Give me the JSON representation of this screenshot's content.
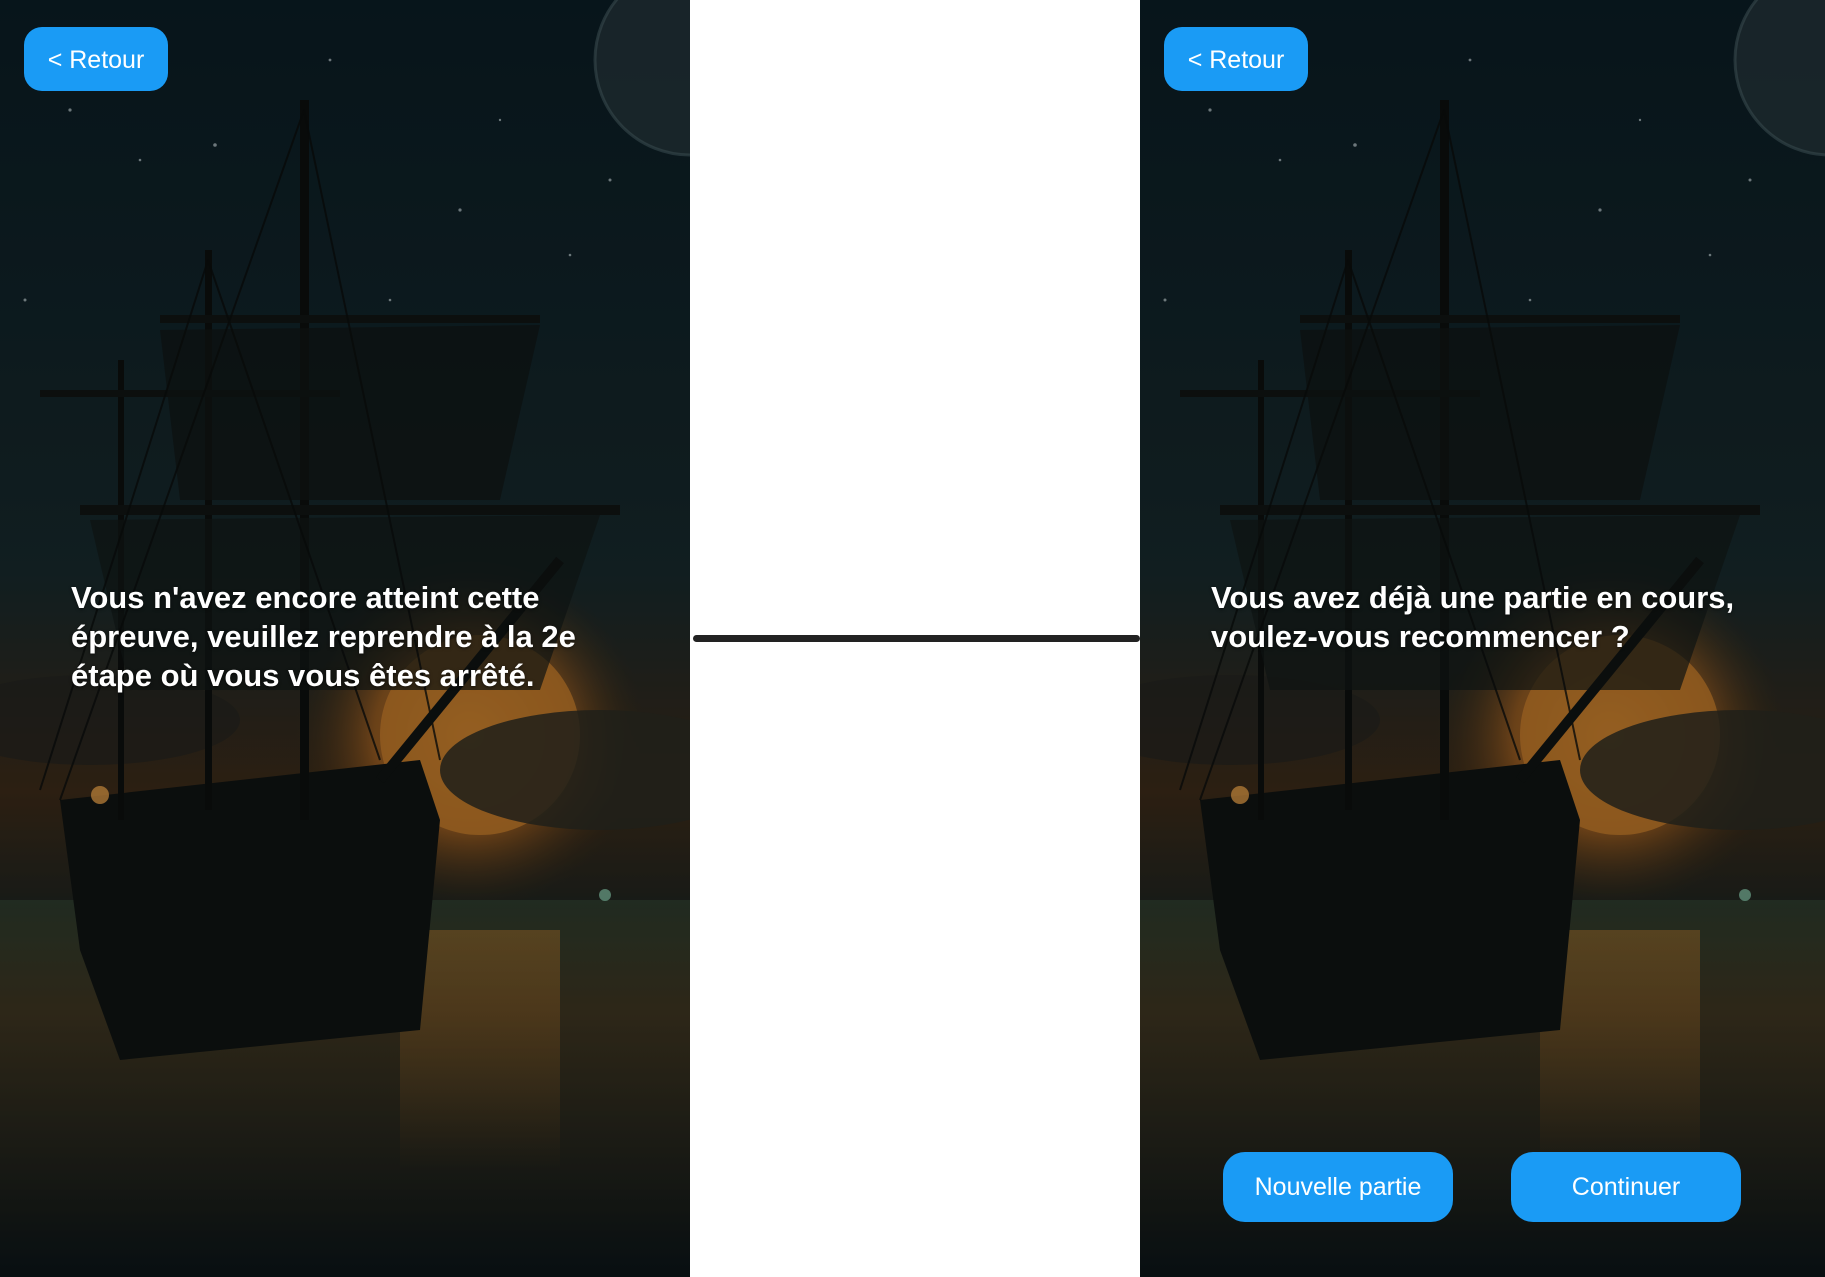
{
  "colors": {
    "button_blue": "#1a9bf5",
    "text_white": "#ffffff",
    "connector_dark": "#222222",
    "sky_night": "#0b1a22",
    "moon_orange": "#c27a2a"
  },
  "icons": {
    "background": "pirate-ship-night-scene",
    "arrow": "connector-line"
  },
  "screen_left": {
    "back_label": "< Retour",
    "message": "Vous n'avez encore atteint cette épreuve, veuillez reprendre à la 2e étape où vous vous êtes arrêté."
  },
  "screen_right": {
    "back_label": "< Retour",
    "message": "Vous avez déjà une partie en cours, voulez-vous recommencer ?",
    "new_game_label": "Nouvelle partie",
    "continue_label": "Continuer"
  }
}
